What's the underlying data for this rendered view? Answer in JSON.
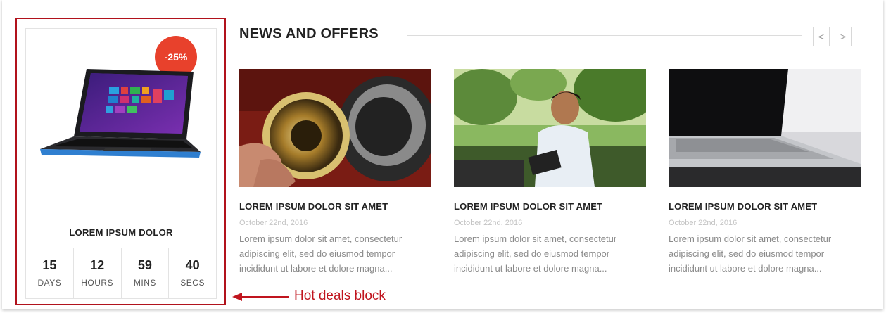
{
  "hot_deal": {
    "discount": "-25%",
    "product_name": "LOREM IPSUM DOLOR",
    "countdown": [
      {
        "value": "15",
        "unit": "DAYS"
      },
      {
        "value": "12",
        "unit": "HOURS"
      },
      {
        "value": "59",
        "unit": "MINS"
      },
      {
        "value": "40",
        "unit": "SECS"
      }
    ]
  },
  "news": {
    "heading": "NEWS AND OFFERS",
    "prev_icon": "chevron-left-icon",
    "next_icon": "chevron-right-icon",
    "prev_label": "<",
    "next_label": ">",
    "posts": [
      {
        "title": "LOREM IPSUM DOLOR SIT AMET",
        "date": "October 22nd, 2016",
        "excerpt": "Lorem ipsum dolor sit amet, consectetur adipiscing elit, sed do eiusmod tempor incididunt ut labore et dolore magna...",
        "image": "camera-lens-photo"
      },
      {
        "title": "LOREM IPSUM DOLOR SIT AMET",
        "date": "October 22nd, 2016",
        "excerpt": "Lorem ipsum dolor sit amet, consectetur adipiscing elit, sed do eiusmod tempor incididunt ut labore et dolore magna...",
        "image": "man-with-tablet-photo"
      },
      {
        "title": "LOREM IPSUM DOLOR SIT AMET",
        "date": "October 22nd, 2016",
        "excerpt": "Lorem ipsum dolor sit amet, consectetur adipiscing elit, sed do eiusmod tempor incididunt ut labore et dolore magna...",
        "image": "laptop-photo"
      }
    ]
  },
  "annotation": {
    "label": "Hot deals block",
    "color": "#c0141e"
  },
  "colors": {
    "discount_badge": "#e8412c",
    "text_dark": "#222222",
    "text_muted": "#8a8a8a"
  }
}
